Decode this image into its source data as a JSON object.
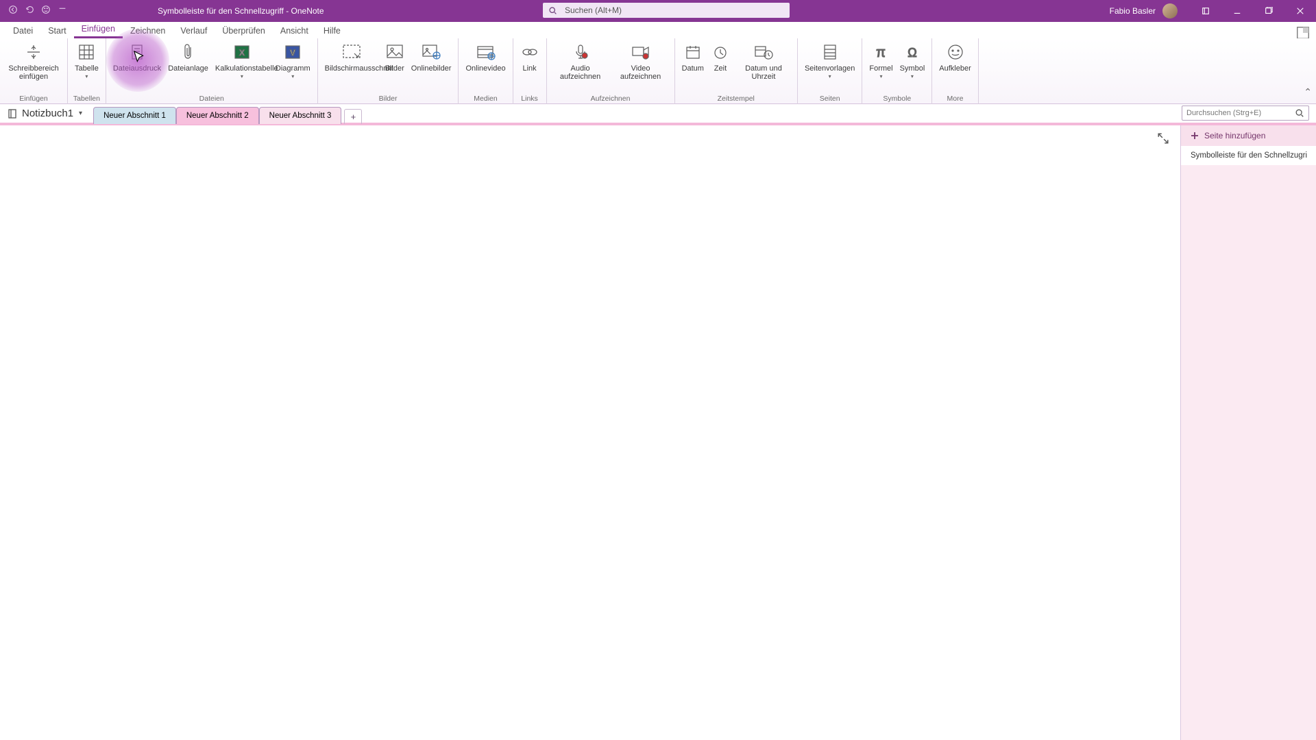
{
  "titlebar": {
    "title": "Symbolleiste für den Schnellzugriff  -  OneNote",
    "search_placeholder": "Suchen (Alt+M)",
    "user": "Fabio Basler"
  },
  "tabs": [
    "Datei",
    "Start",
    "Einfügen",
    "Zeichnen",
    "Verlauf",
    "Überprüfen",
    "Ansicht",
    "Hilfe"
  ],
  "active_tab": 2,
  "ribbon": {
    "groups": [
      {
        "name": "Einfügen",
        "items": [
          {
            "l": "Schreibbereich einfügen",
            "i": "space-insert"
          }
        ]
      },
      {
        "name": "Tabellen",
        "items": [
          {
            "l": "Tabelle",
            "i": "table",
            "dd": true
          }
        ]
      },
      {
        "name": "Dateien",
        "items": [
          {
            "l": "Dateiausdruck",
            "i": "file-print"
          },
          {
            "l": "Dateianlage",
            "i": "paperclip"
          },
          {
            "l": "Kalkulationstabelle",
            "i": "excel",
            "dd": true
          },
          {
            "l": "Diagramm",
            "i": "visio",
            "dd": true
          }
        ]
      },
      {
        "name": "Bilder",
        "items": [
          {
            "l": "Bildschirmausschnitt",
            "i": "screenclip"
          },
          {
            "l": "Bilder",
            "i": "picture"
          },
          {
            "l": "Onlinebilder",
            "i": "online-picture"
          }
        ]
      },
      {
        "name": "Medien",
        "items": [
          {
            "l": "Onlinevideo",
            "i": "video"
          }
        ]
      },
      {
        "name": "Links",
        "items": [
          {
            "l": "Link",
            "i": "link"
          }
        ]
      },
      {
        "name": "Aufzeichnen",
        "items": [
          {
            "l": "Audio aufzeichnen",
            "i": "audio-rec"
          },
          {
            "l": "Video aufzeichnen",
            "i": "video-rec"
          }
        ]
      },
      {
        "name": "Zeitstempel",
        "items": [
          {
            "l": "Datum",
            "i": "date"
          },
          {
            "l": "Zeit",
            "i": "time"
          },
          {
            "l": "Datum und Uhrzeit",
            "i": "datetime"
          }
        ]
      },
      {
        "name": "Seiten",
        "items": [
          {
            "l": "Seitenvorlagen",
            "i": "templates",
            "dd": true
          }
        ]
      },
      {
        "name": "Symbole",
        "items": [
          {
            "l": "Formel",
            "i": "equation",
            "dd": true
          },
          {
            "l": "Symbol",
            "i": "symbol",
            "dd": true
          }
        ]
      },
      {
        "name": "More",
        "items": [
          {
            "l": "Aufkleber",
            "i": "sticker"
          }
        ]
      }
    ]
  },
  "notebook": {
    "name": "Notizbuch1"
  },
  "sections": [
    "Neuer Abschnitt 1",
    "Neuer Abschnitt 2",
    "Neuer Abschnitt 3"
  ],
  "section_search": "Durchsuchen (Strg+E)",
  "right": {
    "add": "Seite hinzufügen",
    "page": "Symbolleiste für den Schnellzugri"
  }
}
